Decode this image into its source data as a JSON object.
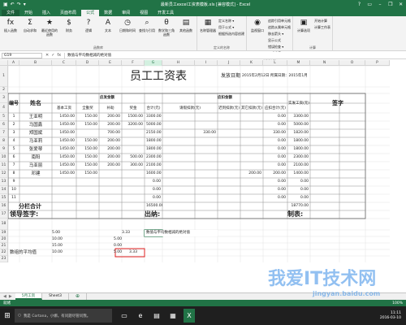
{
  "window": {
    "title": "最新员工excel工资表模板.xls [兼容模式] - Excel",
    "qat_icons": [
      "save-icon",
      "undo-icon",
      "redo-icon",
      "customize-icon"
    ],
    "controls": [
      "?",
      "▭",
      "–",
      "❐",
      "✕"
    ]
  },
  "tabs": [
    "文件",
    "开始",
    "插入",
    "页面布局",
    "公式",
    "数据",
    "审阅",
    "视图",
    "开发工具"
  ],
  "active_tab": "公式",
  "ribbon": {
    "groups": [
      {
        "label": "函数库",
        "big": [
          {
            "icon": "fx",
            "label": "插入函数"
          },
          {
            "icon": "Σ",
            "label": "自动求和"
          },
          {
            "icon": "★",
            "label": "最近使用的函数"
          },
          {
            "icon": "$",
            "label": "财务"
          },
          {
            "icon": "?",
            "label": "逻辑"
          },
          {
            "icon": "A",
            "label": "文本"
          },
          {
            "icon": "◷",
            "label": "日期和时间"
          },
          {
            "icon": "⌕",
            "label": "查找与引用"
          },
          {
            "icon": "θ",
            "label": "数学和三角函数"
          },
          {
            "icon": "▤",
            "label": "其他函数"
          }
        ]
      },
      {
        "label": "定义的名称",
        "big": [
          {
            "icon": "▦",
            "label": "名称管理器"
          }
        ],
        "small": [
          "定义名称 ▾",
          "用于公式 ▾",
          "根据所选内容创建"
        ]
      },
      {
        "label": "公式审核",
        "small": [
          "追踪引用单元格",
          "追踪从属单元格",
          "移去箭头 ▾",
          "显示公式",
          "错误检查 ▾",
          "公式求值"
        ],
        "big": [
          {
            "icon": "◉",
            "label": "监视窗口"
          }
        ]
      },
      {
        "label": "计算",
        "big": [
          {
            "icon": "▣",
            "label": "计算选项"
          }
        ],
        "small": [
          "开始计算",
          "计算工作表"
        ]
      }
    ]
  },
  "formula_bar": {
    "name_box": "G19",
    "buttons": [
      "✕",
      "✓",
      "fx"
    ],
    "content": "数值与平均数相减的绝对值"
  },
  "columns": [
    "A",
    "B",
    "C",
    "D",
    "E",
    "F",
    "G",
    "H",
    "I",
    "J",
    "K",
    "L",
    "M",
    "N",
    "O",
    "P"
  ],
  "selected_column": "G",
  "rows": [
    "1",
    "2",
    "3",
    "4",
    "5",
    "6",
    "7",
    "8",
    "9",
    "10",
    "11",
    "12",
    "13",
    "14",
    "15",
    "16",
    "17",
    "18",
    "19",
    "20",
    "21",
    "22",
    "23"
  ],
  "payroll": {
    "title": "员工工资表",
    "issue_date_label": "发放日期",
    "issue_date": "2015年2月12日 所属日期：2015年1月",
    "header_no": "编号",
    "header_name": "姓名",
    "header_pay": "应发金额",
    "header_deduct": "应扣金额",
    "header_net": "实发工资(元)",
    "header_sign": "签字",
    "sub_headers": [
      "基本工资",
      "全勤奖",
      "补助",
      "奖金",
      "合计(元)",
      "请假扣款(元)",
      "迟到扣款(元)",
      "其它扣款(元)",
      "应扣合计(元)"
    ],
    "employees": [
      {
        "no": "1",
        "name": "王亚明",
        "base": "1450.00",
        "att": "150.00",
        "sub": "200.00",
        "bonus": "1500.00",
        "total": "3300.00",
        "leave": "",
        "late": "",
        "other": "",
        "ded": "0.00",
        "net": "3300.00"
      },
      {
        "no": "2",
        "name": "马国鑫",
        "base": "1450.00",
        "att": "150.00",
        "sub": "200.00",
        "bonus": "3200.00",
        "total": "5000.00",
        "leave": "",
        "late": "",
        "other": "",
        "ded": "0.00",
        "net": "5000.00"
      },
      {
        "no": "3",
        "name": "郑国斌",
        "base": "1450.00",
        "att": "",
        "sub": "700.00",
        "bonus": "",
        "total": "2150.00",
        "leave": "330.00",
        "late": "",
        "other": "",
        "ded": "330.00",
        "net": "1820.00"
      },
      {
        "no": "4",
        "name": "马亚莉",
        "base": "1450.00",
        "att": "150.00",
        "sub": "200.00",
        "bonus": "",
        "total": "1800.00",
        "leave": "",
        "late": "",
        "other": "",
        "ded": "0.00",
        "net": "1800.00"
      },
      {
        "no": "5",
        "name": "张爱琴",
        "base": "1450.00",
        "att": "150.00",
        "sub": "200.00",
        "bonus": "",
        "total": "1800.00",
        "leave": "",
        "late": "",
        "other": "",
        "ded": "0.00",
        "net": "1800.00"
      },
      {
        "no": "6",
        "name": "南阳",
        "base": "1450.00",
        "att": "150.00",
        "sub": "200.00",
        "bonus": "500.00",
        "total": "2300.00",
        "leave": "",
        "late": "",
        "other": "",
        "ded": "0.00",
        "net": "2300.00"
      },
      {
        "no": "7",
        "name": "马亚丽",
        "base": "1450.00",
        "att": "150.00",
        "sub": "200.00",
        "bonus": "300.00",
        "total": "2100.00",
        "leave": "",
        "late": "",
        "other": "",
        "ded": "0.00",
        "net": "2100.00"
      },
      {
        "no": "8",
        "name": "邓建",
        "base": "1450.00",
        "att": "150.00",
        "sub": "",
        "bonus": "",
        "total": "1600.00",
        "leave": "",
        "late": "",
        "other": "200.00",
        "ded": "200.00",
        "net": "1400.00"
      },
      {
        "no": "9",
        "name": "",
        "base": "",
        "att": "",
        "sub": "",
        "bonus": "",
        "total": "0.00",
        "leave": "",
        "late": "",
        "other": "",
        "ded": "0.00",
        "net": "0.00"
      },
      {
        "no": "10",
        "name": "",
        "base": "",
        "att": "",
        "sub": "",
        "bonus": "",
        "total": "0.00",
        "leave": "",
        "late": "",
        "other": "",
        "ded": "0.00",
        "net": "0.00"
      },
      {
        "no": "11",
        "name": "",
        "base": "",
        "att": "",
        "sub": "",
        "bonus": "",
        "total": "0.00",
        "leave": "",
        "late": "",
        "other": "",
        "ded": "0.00",
        "net": "0.00"
      }
    ],
    "subtotal_label": "分栏合计",
    "subtotal_total": "16500.00",
    "subtotal_net": "18770.00",
    "sign_leader": "领导签字:",
    "sign_cashier": "出纳:",
    "sign_maker": "制表:"
  },
  "calc": {
    "r19": [
      "5.00",
      "",
      "3.33"
    ],
    "r19_note": "数值与平均数相减的绝对值",
    "r19_g": "5.00",
    "r20": [
      "10.00",
      "",
      "0.00"
    ],
    "r21": [
      "15.00",
      "",
      "5.00"
    ],
    "avg_label": "数组的平均值",
    "avg_value": "10.00",
    "avg_result": "3.33"
  },
  "sheet_tabs": [
    "5月工资",
    "Sheet3"
  ],
  "active_sheet": "5月工资",
  "status": {
    "left": "就绪",
    "zoom": "100%"
  },
  "taskbar": {
    "search": "我是 Cortana，小娜。有问题尽管问我。",
    "time": "11:11",
    "date": "2016-03-10"
  },
  "watermark": {
    "line1": "我爱IT技术网",
    "line2": "jingyan.baidu.com"
  }
}
